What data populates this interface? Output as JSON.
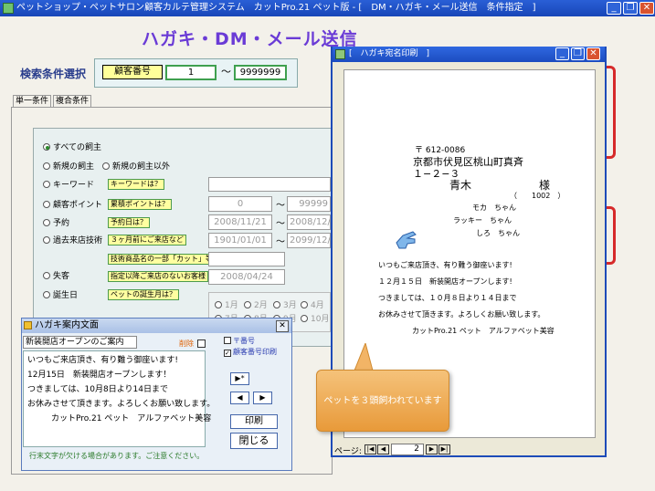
{
  "window": {
    "title": "ペットショップ・ペットサロン顧客カルテ管理システム　カットPro.21 ペット版 - [　DM・ハガキ・メール送信　条件指定　]",
    "min": "_",
    "restore": "❐",
    "close": "✕"
  },
  "page": {
    "heading": "ハガキ・DM・メール送信"
  },
  "search": {
    "label": "検索条件選択",
    "field_button": "顧客番号",
    "from": "1",
    "tilde": "〜",
    "to": "9999999"
  },
  "tabs": [
    {
      "label": "単一条件",
      "active": true
    },
    {
      "label": "複合条件",
      "active": false
    }
  ],
  "conditions": {
    "all_owners": "すべての飼主",
    "new_owners": "新規の飼主",
    "not_new_owners": "新規の飼主以外",
    "keyword": "キーワード",
    "keyword_hint": "キーワードは？",
    "points": "顧客ポイント",
    "points_hint": "累積ポイントは？",
    "points_from": "0",
    "points_to": "99999",
    "reservation": "予約",
    "reservation_hint": "予約日は？",
    "reservation_from": "2008/11/21",
    "reservation_to": "2008/12/",
    "past_tech": "過去来店技術",
    "past_tech_hint": "３ヶ月前にご来店など",
    "past_from": "1901/01/01",
    "past_to": "2099/12/",
    "product_hint": "技術商品名の一部「カット」等",
    "lost": "失客",
    "lost_hint": "指定以降ご来店のないお客様",
    "lost_date": "2008/04/24",
    "birthday": "誕生日",
    "birthday_hint": "ペットの誕生月は？",
    "months_row1": [
      "1月",
      "2月",
      "3月",
      "4月"
    ],
    "months_row2": [
      "7月",
      "8月",
      "9月",
      "10月"
    ]
  },
  "preview": {
    "title": "[　ハガキ宛名印刷　]",
    "zip": "〒 612-0086",
    "address1": "京都市伏見区桃山町真斉",
    "address2": "１−２−３",
    "name": "青木",
    "honorific": "様",
    "customer_no": "（　　1002　）",
    "pets": [
      "モカ　ちゃん",
      "ラッキー　ちゃん",
      "しろ　ちゃん"
    ],
    "message": [
      "いつもご来店頂き、有り難う御座います!",
      "１２月１５日　新装開店オープンします!",
      "つきましては、１０月８日より１４日まで",
      "お休みさせて頂きます。よろしくお願い致します。",
      "カットPro.21 ペット　アルファベット美容"
    ],
    "page_label": "ページ:",
    "page_number": "2"
  },
  "dialog": {
    "title": "ハガキ案内文面",
    "subject": "新装開店オープンのご案内",
    "delete_label": "削除",
    "zip_check": "〒番号",
    "print_customer_no": "顧客番号印刷",
    "lines": [
      "いつもご来店頂き、有り難う御座います!",
      "12月15日　新装開店オープンします！",
      "つきましては、10月8日より14日まで",
      "お休みさせて頂きます。よろしくお願い致します。",
      "カットPro.21 ペット　アルファベット美容"
    ],
    "nav_last": "▶*",
    "nav_prev": "◀",
    "nav_next": "▶",
    "print_button": "印刷",
    "close_button": "閉じる",
    "footer": "行末文字が欠ける場合があります。ご注意ください。"
  },
  "tooltip": {
    "text": "ペットを３頭飼われています"
  }
}
